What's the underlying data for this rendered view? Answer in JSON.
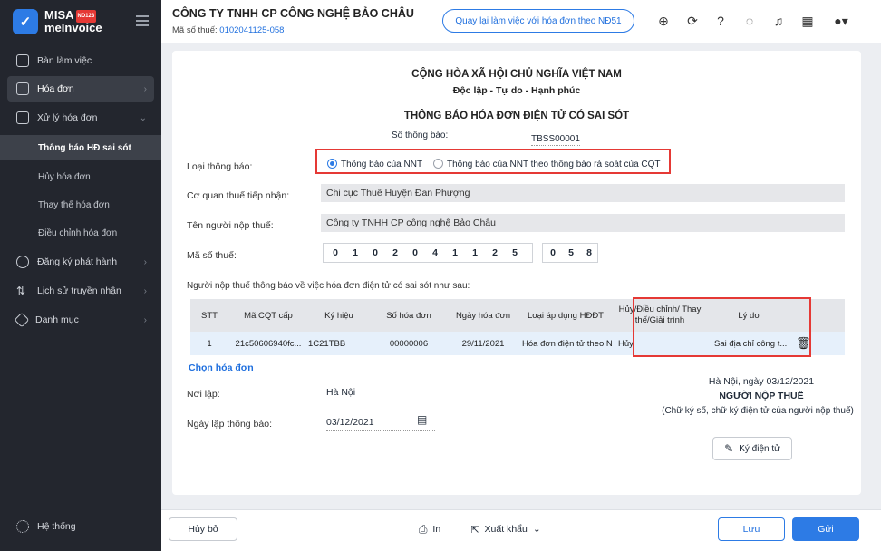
{
  "sidebar": {
    "brand_line1": "MISA",
    "brand_badge": "ND123",
    "brand_line2": "meInvoice",
    "items": [
      {
        "label": "Bàn làm việc",
        "icon": "monitor-icon"
      },
      {
        "label": "Hóa đơn",
        "icon": "invoice-icon"
      },
      {
        "label": "Xử lý hóa đơn",
        "icon": "process-icon"
      },
      {
        "label": "Đăng ký phát hành",
        "icon": "register-icon"
      },
      {
        "label": "Lịch sử truyền nhận",
        "icon": "transfer-icon"
      },
      {
        "label": "Danh mục",
        "icon": "catalog-icon"
      }
    ],
    "sub_items": [
      "Thông báo HĐ sai sót",
      "Hủy hóa đơn",
      "Thay thế hóa đơn",
      "Điều chỉnh hóa đơn"
    ],
    "system": "Hệ thống"
  },
  "header": {
    "company": "CÔNG TY TNHH CP CÔNG NGHỆ BẢO CHÂU",
    "tax_label": "Mã số thuế:",
    "tax_value": "0102041125-058",
    "back_button": "Quay lại làm việc với hóa đơn theo NĐ51"
  },
  "form": {
    "nation": "CỘNG HÒA XÃ HỘI CHỦ NGHĨA VIỆT NAM",
    "motto": "Độc lập - Tự do - Hạnh phúc",
    "title": "THÔNG BÁO HÓA ĐƠN ĐIỆN TỬ CÓ SAI SÓT",
    "number_label": "Số thông báo:",
    "number_value": "TBSS00001",
    "type_label": "Loại thông báo:",
    "type_option1": "Thông báo của NNT",
    "type_option2": "Thông báo của NNT theo thông báo rà soát của CQT",
    "tax_office_label": "Cơ quan thuế tiếp nhận:",
    "tax_office_value": "Chi cục Thuế Huyện Đan Phượng",
    "taxpayer_label": "Tên người nộp thuế:",
    "taxpayer_value": "Công ty TNHH CP công nghệ Bảo Châu",
    "tax_code_label": "Mã số thuế:",
    "tax_code_digits": [
      "0",
      "1",
      "0",
      "2",
      "0",
      "4",
      "1",
      "1",
      "2",
      "5",
      "0",
      "5",
      "8"
    ],
    "intro": "Người nộp thuế thông báo về việc hóa đơn điện tử có sai sót như sau:",
    "table": {
      "headers": [
        "STT",
        "Mã CQT cấp",
        "Ký hiệu",
        "Số hóa đơn",
        "Ngày hóa đơn",
        "Loại áp dụng HĐĐT",
        "Hủy/Điều chỉnh/ Thay thế/Giải trình",
        "Lý do"
      ],
      "row": [
        "1",
        "21c50606940fc...",
        "1C21TBB",
        "00000006",
        "29/11/2021",
        "Hóa đơn điện tử theo Nị",
        "Hủy",
        "Sai địa chỉ công t..."
      ]
    },
    "choose_invoice": "Chọn hóa đơn",
    "place_label": "Nơi lập:",
    "place_value": "Hà Nội",
    "date_label": "Ngày lập thông báo:",
    "date_value": "03/12/2021",
    "sign_date": "Hà Nội, ngày 03/12/2021",
    "signer_title": "NGƯỜI NỘP THUẾ",
    "signer_note": "(Chữ ký số, chữ ký điện tử của người nộp thuế)",
    "sign_button": "Ký điện tử"
  },
  "footer": {
    "cancel": "Hủy bỏ",
    "print": "In",
    "export": "Xuất khẩu",
    "save": "Lưu",
    "send": "Gửi"
  },
  "colors": {
    "accent": "#2d7be5",
    "highlight": "#e53935",
    "sidebar": "#23262e"
  }
}
